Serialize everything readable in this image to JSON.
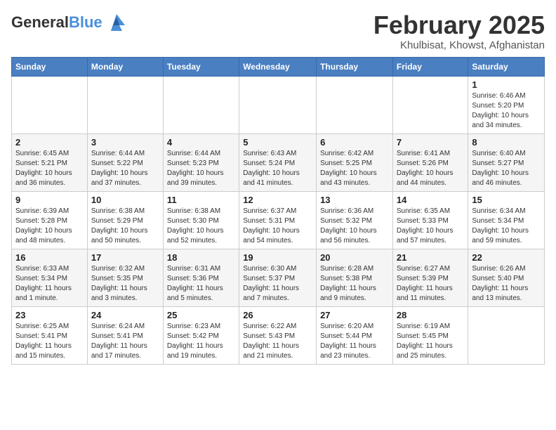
{
  "logo": {
    "line1": "General",
    "line2": "Blue"
  },
  "title": "February 2025",
  "subtitle": "Khulbisat, Khowst, Afghanistan",
  "days_of_week": [
    "Sunday",
    "Monday",
    "Tuesday",
    "Wednesday",
    "Thursday",
    "Friday",
    "Saturday"
  ],
  "weeks": [
    [
      {
        "day": "",
        "info": ""
      },
      {
        "day": "",
        "info": ""
      },
      {
        "day": "",
        "info": ""
      },
      {
        "day": "",
        "info": ""
      },
      {
        "day": "",
        "info": ""
      },
      {
        "day": "",
        "info": ""
      },
      {
        "day": "1",
        "info": "Sunrise: 6:46 AM\nSunset: 5:20 PM\nDaylight: 10 hours\nand 34 minutes."
      }
    ],
    [
      {
        "day": "2",
        "info": "Sunrise: 6:45 AM\nSunset: 5:21 PM\nDaylight: 10 hours\nand 36 minutes."
      },
      {
        "day": "3",
        "info": "Sunrise: 6:44 AM\nSunset: 5:22 PM\nDaylight: 10 hours\nand 37 minutes."
      },
      {
        "day": "4",
        "info": "Sunrise: 6:44 AM\nSunset: 5:23 PM\nDaylight: 10 hours\nand 39 minutes."
      },
      {
        "day": "5",
        "info": "Sunrise: 6:43 AM\nSunset: 5:24 PM\nDaylight: 10 hours\nand 41 minutes."
      },
      {
        "day": "6",
        "info": "Sunrise: 6:42 AM\nSunset: 5:25 PM\nDaylight: 10 hours\nand 43 minutes."
      },
      {
        "day": "7",
        "info": "Sunrise: 6:41 AM\nSunset: 5:26 PM\nDaylight: 10 hours\nand 44 minutes."
      },
      {
        "day": "8",
        "info": "Sunrise: 6:40 AM\nSunset: 5:27 PM\nDaylight: 10 hours\nand 46 minutes."
      }
    ],
    [
      {
        "day": "9",
        "info": "Sunrise: 6:39 AM\nSunset: 5:28 PM\nDaylight: 10 hours\nand 48 minutes."
      },
      {
        "day": "10",
        "info": "Sunrise: 6:38 AM\nSunset: 5:29 PM\nDaylight: 10 hours\nand 50 minutes."
      },
      {
        "day": "11",
        "info": "Sunrise: 6:38 AM\nSunset: 5:30 PM\nDaylight: 10 hours\nand 52 minutes."
      },
      {
        "day": "12",
        "info": "Sunrise: 6:37 AM\nSunset: 5:31 PM\nDaylight: 10 hours\nand 54 minutes."
      },
      {
        "day": "13",
        "info": "Sunrise: 6:36 AM\nSunset: 5:32 PM\nDaylight: 10 hours\nand 56 minutes."
      },
      {
        "day": "14",
        "info": "Sunrise: 6:35 AM\nSunset: 5:33 PM\nDaylight: 10 hours\nand 57 minutes."
      },
      {
        "day": "15",
        "info": "Sunrise: 6:34 AM\nSunset: 5:34 PM\nDaylight: 10 hours\nand 59 minutes."
      }
    ],
    [
      {
        "day": "16",
        "info": "Sunrise: 6:33 AM\nSunset: 5:34 PM\nDaylight: 11 hours\nand 1 minute."
      },
      {
        "day": "17",
        "info": "Sunrise: 6:32 AM\nSunset: 5:35 PM\nDaylight: 11 hours\nand 3 minutes."
      },
      {
        "day": "18",
        "info": "Sunrise: 6:31 AM\nSunset: 5:36 PM\nDaylight: 11 hours\nand 5 minutes."
      },
      {
        "day": "19",
        "info": "Sunrise: 6:30 AM\nSunset: 5:37 PM\nDaylight: 11 hours\nand 7 minutes."
      },
      {
        "day": "20",
        "info": "Sunrise: 6:28 AM\nSunset: 5:38 PM\nDaylight: 11 hours\nand 9 minutes."
      },
      {
        "day": "21",
        "info": "Sunrise: 6:27 AM\nSunset: 5:39 PM\nDaylight: 11 hours\nand 11 minutes."
      },
      {
        "day": "22",
        "info": "Sunrise: 6:26 AM\nSunset: 5:40 PM\nDaylight: 11 hours\nand 13 minutes."
      }
    ],
    [
      {
        "day": "23",
        "info": "Sunrise: 6:25 AM\nSunset: 5:41 PM\nDaylight: 11 hours\nand 15 minutes."
      },
      {
        "day": "24",
        "info": "Sunrise: 6:24 AM\nSunset: 5:41 PM\nDaylight: 11 hours\nand 17 minutes."
      },
      {
        "day": "25",
        "info": "Sunrise: 6:23 AM\nSunset: 5:42 PM\nDaylight: 11 hours\nand 19 minutes."
      },
      {
        "day": "26",
        "info": "Sunrise: 6:22 AM\nSunset: 5:43 PM\nDaylight: 11 hours\nand 21 minutes."
      },
      {
        "day": "27",
        "info": "Sunrise: 6:20 AM\nSunset: 5:44 PM\nDaylight: 11 hours\nand 23 minutes."
      },
      {
        "day": "28",
        "info": "Sunrise: 6:19 AM\nSunset: 5:45 PM\nDaylight: 11 hours\nand 25 minutes."
      },
      {
        "day": "",
        "info": ""
      }
    ]
  ]
}
